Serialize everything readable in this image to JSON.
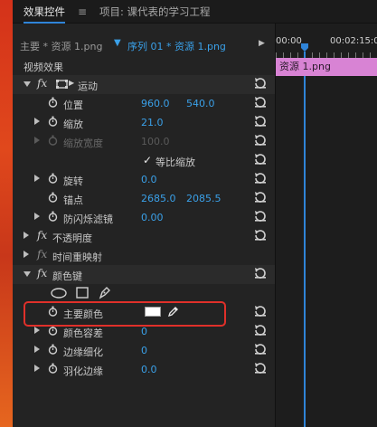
{
  "tabs": {
    "active": "效果控件",
    "menu_glyph": "≡",
    "inactive": "项目: 课代表的学习工程"
  },
  "header": {
    "master": "主要 * 资源 1.png",
    "sequence": "序列 01 * 资源 1.png"
  },
  "timeline": {
    "time_start": "00:00",
    "time_mid": "00:02:15:0",
    "clip_label": "资源 1.png"
  },
  "sections": {
    "video_effects": "视频效果",
    "motion": "运动",
    "opacity": "不透明度",
    "time_remap": "时间重映射",
    "color_key": "颜色键"
  },
  "props": {
    "position": {
      "label": "位置",
      "x": "960.0",
      "y": "540.0"
    },
    "scale": {
      "label": "缩放",
      "value": "21.0"
    },
    "scale_width": {
      "label": "缩放宽度",
      "value": "100.0"
    },
    "uniform_scale": {
      "check": "✓",
      "label": "等比缩放"
    },
    "rotation": {
      "label": "旋转",
      "value": "0.0"
    },
    "anchor": {
      "label": "锚点",
      "x": "2685.0",
      "y": "2085.5"
    },
    "anti_flicker": {
      "label": "防闪烁滤镜",
      "value": "0.00"
    },
    "key_color": {
      "label": "主要颜色"
    },
    "color_tolerance": {
      "label": "颜色容差",
      "value": "0"
    },
    "edge_thin": {
      "label": "边缘细化",
      "value": "0"
    },
    "feather": {
      "label": "羽化边缘",
      "value": "0.0"
    }
  },
  "colors": {
    "accent_blue": "#3aa0e8",
    "clip_pink": "#d883d4",
    "highlight_red": "#e0302a",
    "key_swatch": "#ffffff"
  }
}
